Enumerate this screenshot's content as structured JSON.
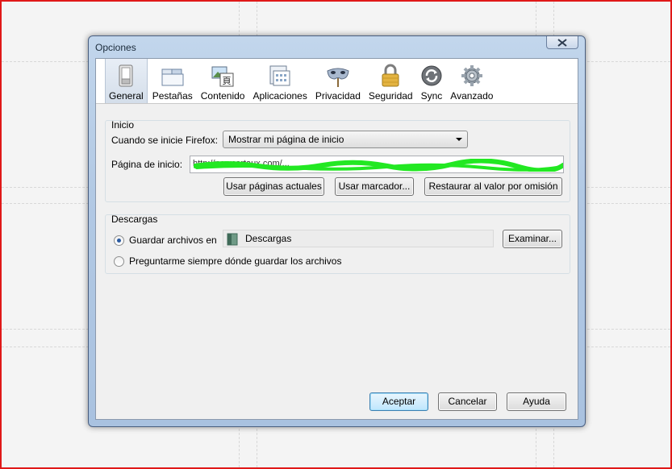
{
  "window": {
    "title": "Opciones"
  },
  "toolbar": {
    "items": [
      {
        "label": "General",
        "icon": "switch-icon",
        "active": true
      },
      {
        "label": "Pestañas",
        "icon": "tabs-icon",
        "active": false
      },
      {
        "label": "Contenido",
        "icon": "content-icon",
        "active": false
      },
      {
        "label": "Aplicaciones",
        "icon": "applications-icon",
        "active": false
      },
      {
        "label": "Privacidad",
        "icon": "mask-icon",
        "active": false
      },
      {
        "label": "Seguridad",
        "icon": "padlock-icon",
        "active": false
      },
      {
        "label": "Sync",
        "icon": "sync-icon",
        "active": false
      },
      {
        "label": "Avanzado",
        "icon": "gear-icon",
        "active": false
      }
    ]
  },
  "startup": {
    "group_label": "Inicio",
    "when_label": "Cuando se inicie Firefox:",
    "when_value": "Mostrar mi página de inicio",
    "homepage_label": "Página de inicio:",
    "homepage_value": "http://newcartaux.com/...",
    "use_current_button": "Usar páginas actuales",
    "use_bookmark_button": "Usar marcador...",
    "restore_default_button": "Restaurar al valor por omisión"
  },
  "downloads": {
    "group_label": "Descargas",
    "save_files_label": "Guardar archivos en",
    "folder_value": "Descargas",
    "browse_button": "Examinar...",
    "always_ask_label": "Preguntarme siempre dónde guardar los archivos"
  },
  "footer": {
    "accept_button": "Aceptar",
    "cancel_button": "Cancelar",
    "help_button": "Ayuda"
  },
  "colors": {
    "scribble": "#22e822",
    "window_frame": "#b2c9e4",
    "screenshot_border": "#e01818"
  }
}
